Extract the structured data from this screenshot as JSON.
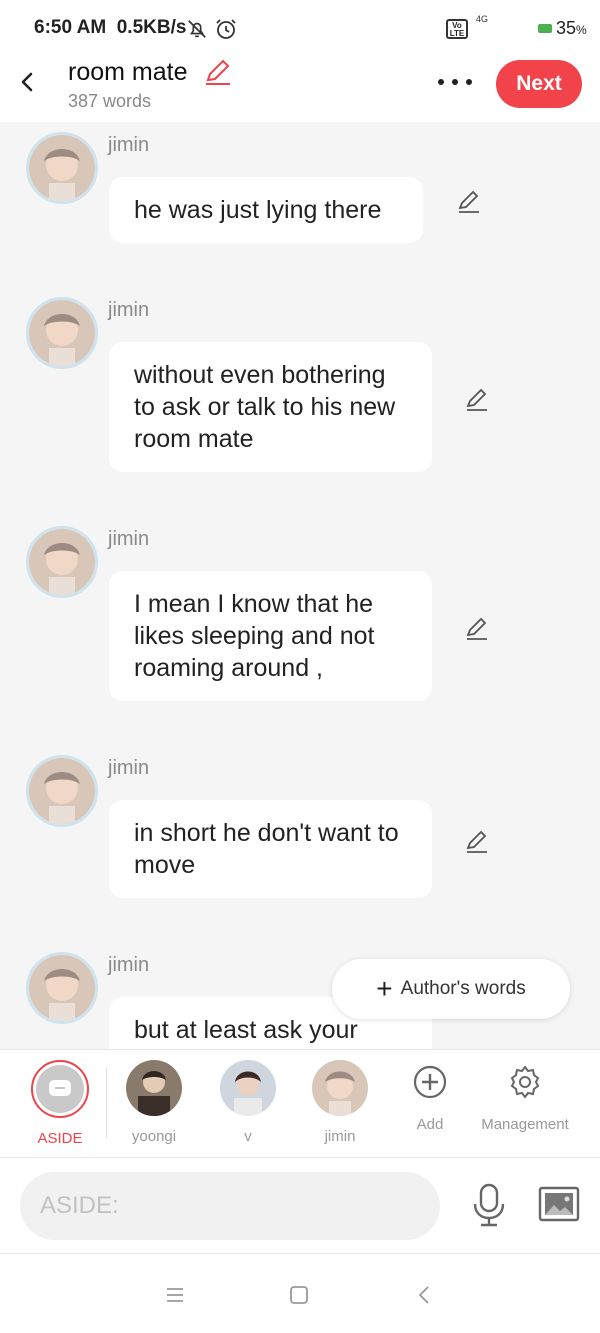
{
  "status_bar": {
    "time": "6:50 AM",
    "speed": "0.5KB/s",
    "volte": "Vo LTE",
    "network": "4G",
    "battery": "35",
    "battery_unit": "%"
  },
  "header": {
    "title": "room mate",
    "word_count": "387 words",
    "next_label": "Next",
    "accent_color": "#f2424a"
  },
  "messages": [
    {
      "speaker": "jimin",
      "text": "he was just lying there"
    },
    {
      "speaker": "jimin",
      "text": "without even bothering to ask or talk to his new room mate"
    },
    {
      "speaker": "jimin",
      "text": "I mean I know that he likes sleeping and not roaming around ,"
    },
    {
      "speaker": "jimin",
      "text": "in short he don't want to move"
    },
    {
      "speaker": "jimin",
      "text": "but at least ask your"
    }
  ],
  "author_words_label": "Author's words",
  "characters": {
    "aside": "ASIDE",
    "yoongi": "yoongi",
    "v": "v",
    "jimin": "jimin",
    "add": "Add",
    "management": "Management"
  },
  "input": {
    "placeholder": "ASIDE:"
  }
}
